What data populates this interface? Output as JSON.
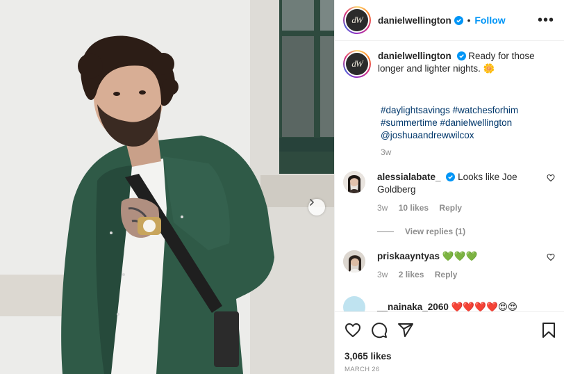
{
  "post": {
    "username": "danielwellington",
    "avatar_monogram": "dW",
    "follow_label": "Follow",
    "separator": "•",
    "more_label": "•••",
    "caption": "Ready for those longer and lighter nights. 🌼",
    "hashtags": [
      "#daylightsavings",
      "#watchesforhim",
      "#summertime",
      "#danielwellington",
      "@joshuaandrewwilcox"
    ],
    "caption_age": "3w"
  },
  "comments": [
    {
      "username": "alessialabate_",
      "verified": true,
      "text": "Looks like Joe Goldberg",
      "age": "3w",
      "likes": "10 likes",
      "reply_label": "Reply",
      "view_replies": "View replies (1)"
    },
    {
      "username": "priskaayntyas",
      "verified": false,
      "text": "💚💚💚",
      "age": "3w",
      "likes": "2 likes",
      "reply_label": "Reply"
    },
    {
      "username": "__nainaka_2060",
      "text": "❤️❤️❤️❤️😍😍"
    }
  ],
  "footer": {
    "likes": "3,065 likes",
    "date": "MARCH 26"
  },
  "colors": {
    "accent": "#0095f6",
    "hashtag": "#00376b",
    "muted": "#8e8e8e",
    "jacket": "#2f5a47"
  },
  "icons": [
    "verified-icon",
    "more-icon",
    "heart-icon",
    "comment-icon",
    "share-icon",
    "bookmark-icon",
    "chevron-right-icon"
  ]
}
